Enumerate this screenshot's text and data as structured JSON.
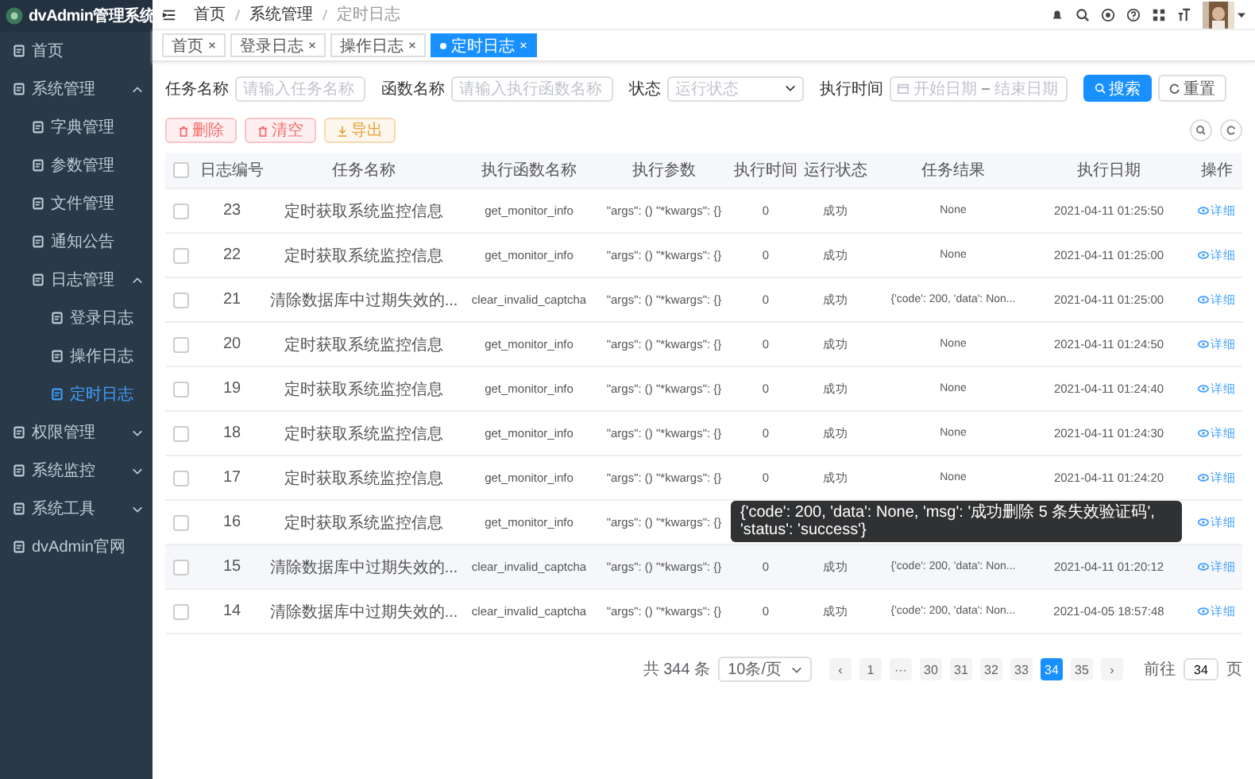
{
  "app_title": "dvAdmin管理系统",
  "sidebar": {
    "items": [
      {
        "label": "首页",
        "selected": false
      },
      {
        "label": "系统管理",
        "selected": false,
        "expanded": true,
        "children": [
          {
            "label": "字典管理",
            "selected": false
          },
          {
            "label": "参数管理",
            "selected": false
          },
          {
            "label": "文件管理",
            "selected": false
          },
          {
            "label": "通知公告",
            "selected": false
          },
          {
            "label": "日志管理",
            "selected": false,
            "expanded": true,
            "children": [
              {
                "label": "登录日志",
                "selected": false
              },
              {
                "label": "操作日志",
                "selected": false
              },
              {
                "label": "定时日志",
                "selected": true
              }
            ]
          }
        ]
      },
      {
        "label": "权限管理",
        "selected": false,
        "expanded": false
      },
      {
        "label": "系统监控",
        "selected": false,
        "expanded": false
      },
      {
        "label": "系统工具",
        "selected": false,
        "expanded": false
      },
      {
        "label": "dvAdmin官网",
        "selected": false
      }
    ]
  },
  "breadcrumb": [
    "首页",
    "系统管理",
    "定时日志"
  ],
  "tabs": [
    {
      "label": "首页",
      "selected": false
    },
    {
      "label": "登录日志",
      "selected": false
    },
    {
      "label": "操作日志",
      "selected": false
    },
    {
      "label": "定时日志",
      "selected": true
    }
  ],
  "filters": [
    {
      "label": "任务名称",
      "placeholder": "请输入任务名称",
      "kind": "text"
    },
    {
      "label": "函数名称",
      "placeholder": "请输入执行函数名称",
      "kind": "text"
    },
    {
      "label": "状态",
      "placeholder": "运行状态",
      "kind": "select"
    },
    {
      "label": "执行时间",
      "placeholder": "开始日期",
      "placeholder_end": "结束日期",
      "kind": "daterange"
    }
  ],
  "search_button": "搜索",
  "reset_button": "重置",
  "actions": [
    {
      "label": "删除",
      "kind": "danger"
    },
    {
      "label": "清空",
      "kind": "danger"
    },
    {
      "label": "导出",
      "kind": "warning"
    }
  ],
  "table": {
    "all_checked": false,
    "columns": [
      "日志编号",
      "任务名称",
      "执行函数名称",
      "执行参数",
      "执行时间",
      "运行状态",
      "任务结果",
      "执行日期",
      "操作"
    ],
    "rows": [
      {
        "checked": false,
        "cells": [
          "23",
          "定时获取系统监控信息",
          "get_monitor_info",
          "\"args\": () \"*kwargs\": {}",
          "0",
          "成功",
          "None",
          "2021-04-11 01:25:50"
        ],
        "action": "详细"
      },
      {
        "checked": false,
        "cells": [
          "22",
          "定时获取系统监控信息",
          "get_monitor_info",
          "\"args\": () \"*kwargs\": {}",
          "0",
          "成功",
          "None",
          "2021-04-11 01:25:00"
        ],
        "action": "详细"
      },
      {
        "checked": false,
        "cells": [
          "21",
          "清除数据库中过期失效的...",
          "clear_invalid_captcha",
          "\"args\": () \"*kwargs\": {}",
          "0",
          "成功",
          "{'code': 200, 'data': Non...",
          "2021-04-11 01:25:00"
        ],
        "action": "详细"
      },
      {
        "checked": false,
        "cells": [
          "20",
          "定时获取系统监控信息",
          "get_monitor_info",
          "\"args\": () \"*kwargs\": {}",
          "0",
          "成功",
          "None",
          "2021-04-11 01:24:50"
        ],
        "action": "详细"
      },
      {
        "checked": false,
        "cells": [
          "19",
          "定时获取系统监控信息",
          "get_monitor_info",
          "\"args\": () \"*kwargs\": {}",
          "0",
          "成功",
          "None",
          "2021-04-11 01:24:40"
        ],
        "action": "详细"
      },
      {
        "checked": false,
        "cells": [
          "18",
          "定时获取系统监控信息",
          "get_monitor_info",
          "\"args\": () \"*kwargs\": {}",
          "0",
          "成功",
          "None",
          "2021-04-11 01:24:30"
        ],
        "action": "详细"
      },
      {
        "checked": false,
        "cells": [
          "17",
          "定时获取系统监控信息",
          "get_monitor_info",
          "\"args\": () \"*kwargs\": {}",
          "0",
          "成功",
          "None",
          "2021-04-11 01:24:20"
        ],
        "action": "详细"
      },
      {
        "checked": false,
        "cells": [
          "16",
          "定时获取系统监控信息",
          "get_monitor_info",
          "\"args\": () \"*kwargs\": {}"
        ],
        "action": "详细"
      },
      {
        "checked": false,
        "hover": true,
        "cells": [
          "15",
          "清除数据库中过期失效的...",
          "clear_invalid_captcha",
          "\"args\": () \"*kwargs\": {}",
          "0",
          "成功",
          "{'code': 200, 'data': Non...",
          "2021-04-11 01:20:12"
        ],
        "action": "详细",
        "tooltip": "{'code': 200, 'data': None, 'msg': '成功删除 5 条失效验证码', 'status': 'success'}"
      },
      {
        "checked": false,
        "cells": [
          "14",
          "清除数据库中过期失效的...",
          "clear_invalid_captcha",
          "\"args\": () \"*kwargs\": {}",
          "0",
          "成功",
          "{'code': 200, 'data': Non...",
          "2021-04-05 18:57:48"
        ],
        "action": "详细"
      }
    ]
  },
  "pagination": {
    "total": "共 344 条",
    "page_size": "10条/页",
    "prev": "‹",
    "next": "›",
    "pages": [
      {
        "label": "1",
        "selected": false
      },
      {
        "label": "···",
        "selected": false
      },
      {
        "label": "30",
        "selected": false
      },
      {
        "label": "31",
        "selected": false
      },
      {
        "label": "32",
        "selected": false
      },
      {
        "label": "33",
        "selected": false
      },
      {
        "label": "34",
        "selected": true
      },
      {
        "label": "35",
        "selected": false
      }
    ],
    "goto_label": "前往",
    "goto_value": "34",
    "goto_unit": "页"
  }
}
